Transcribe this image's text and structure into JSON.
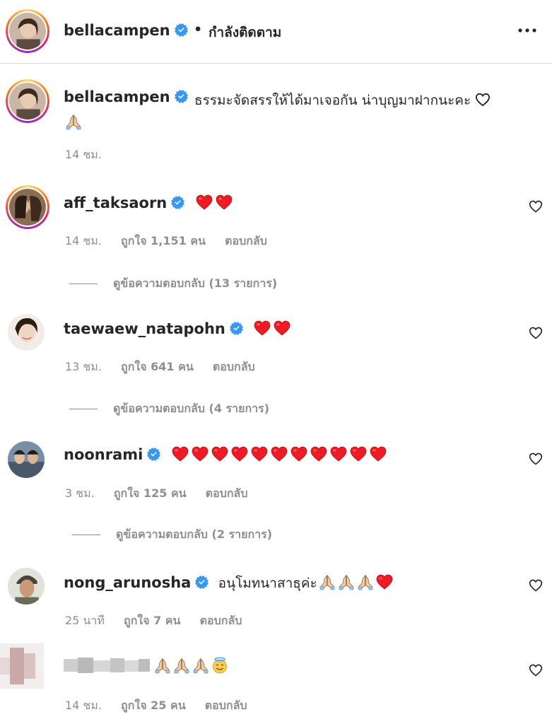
{
  "header": {
    "username": "bellacampen",
    "dot": "•",
    "follow_status": "กำลังติดตาม",
    "more_icon": "more-horizontal-icon"
  },
  "caption": {
    "username": "bellacampen",
    "text": "ธรรมะจัดสรรให้ได้มาเจอกัน น่าบุญมาฝากนะคะ",
    "time": "14 ชม."
  },
  "comments": [
    {
      "username": "aff_taksaorn",
      "verified": true,
      "emojis": [
        "red-heart",
        "red-heart"
      ],
      "time": "14 ชม.",
      "likes": "ถูกใจ 1,151 คน",
      "reply": "ตอบกลับ",
      "view_replies": "ดูข้อความตอบกลับ (13 รายการ)"
    },
    {
      "username": "taewaew_natapohn",
      "verified": true,
      "emojis": [
        "red-heart",
        "red-heart"
      ],
      "time": "13 ชม.",
      "likes": "ถูกใจ 641 คน",
      "reply": "ตอบกลับ",
      "view_replies": "ดูข้อความตอบกลับ (4 รายการ)"
    },
    {
      "username": "noonrami",
      "verified": true,
      "emojis": [
        "red-heart",
        "red-heart",
        "red-heart",
        "red-heart",
        "red-heart",
        "red-heart",
        "red-heart",
        "red-heart",
        "red-heart",
        "red-heart",
        "red-heart"
      ],
      "time": "3 ชม.",
      "likes": "ถูกใจ 125 คน",
      "reply": "ตอบกลับ",
      "view_replies": "ดูข้อความตอบกลับ (2 รายการ)"
    },
    {
      "username": "nong_arunosha",
      "verified": true,
      "text": "อนุโมทนาสาธุค่ะ",
      "emojis": [
        "folded-hands",
        "folded-hands",
        "folded-hands",
        "red-heart"
      ],
      "time": "25 นาที",
      "likes": "ถูกใจ 7 คน",
      "reply": "ตอบกลับ"
    },
    {
      "username": "",
      "verified": false,
      "emojis": [
        "folded-hands",
        "folded-hands",
        "folded-hands",
        "smiling-face-with-halo"
      ],
      "time": "14 ชม.",
      "likes": "ถูกใจ 25 คน",
      "reply": "ตอบกลับ"
    }
  ],
  "colors": {
    "text": "#262626",
    "meta": "#8e8e8e",
    "verified": "#3897f0",
    "heart": "#ed1c24",
    "divider": "#dbdbdb"
  }
}
